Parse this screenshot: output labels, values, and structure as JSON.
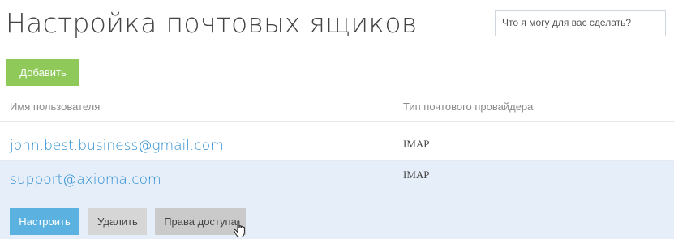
{
  "header": {
    "title": "Настройка почтовых ящиков",
    "search_placeholder": "Что я могу для вас сделать?"
  },
  "toolbar": {
    "add_label": "Добавить"
  },
  "table": {
    "columns": [
      "Имя пользователя",
      "Тип почтового провайдера"
    ],
    "rows": [
      {
        "email": "john.best.business@gmail.com",
        "provider": "IMAP"
      },
      {
        "email": "support@axioma.com",
        "provider": "IMAP"
      }
    ]
  },
  "row_actions": {
    "configure_label": "Настроить",
    "delete_label": "Удалить",
    "access_label": "Права доступа"
  },
  "colors": {
    "add_button": "#8ec95a",
    "primary_button": "#5bb1e0",
    "link": "#2d8ed1",
    "selected_row": "#e6eef9"
  }
}
